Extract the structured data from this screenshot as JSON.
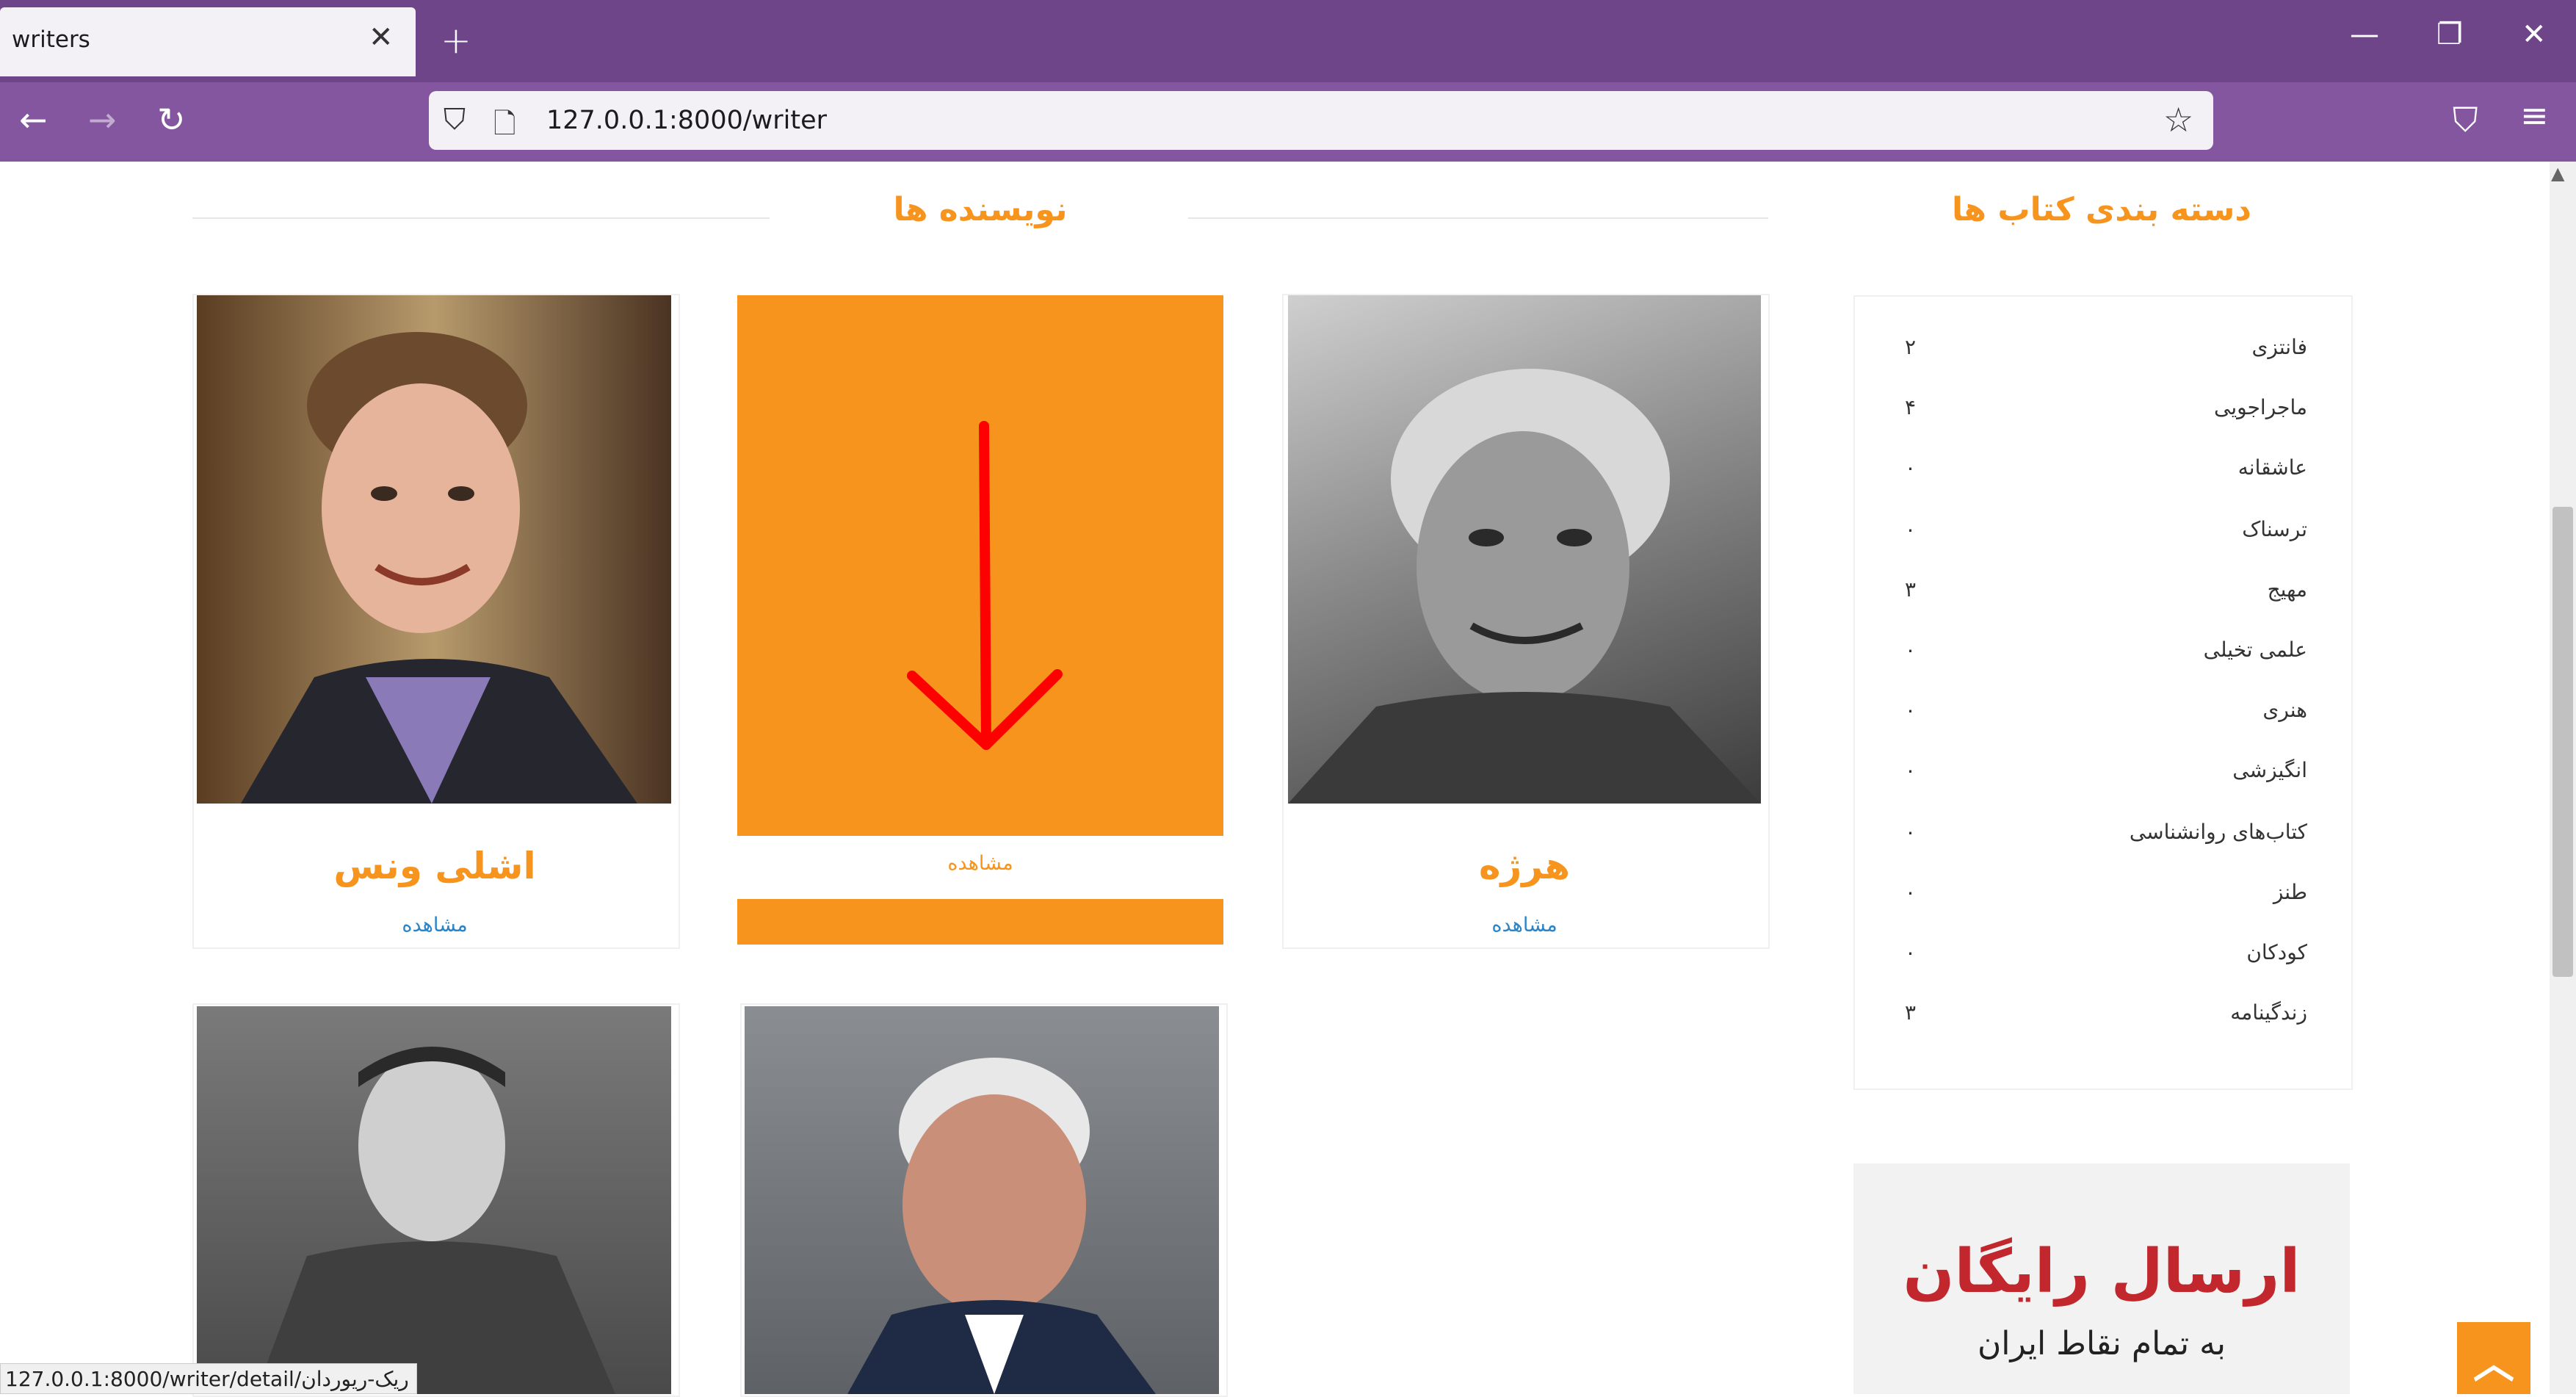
{
  "browser": {
    "tab_title": "writers",
    "tab_close": "✕",
    "new_tab": "+",
    "url": "127.0.0.1:8000/writer",
    "status_url": "127.0.0.1:8000/writer/detail/ریک-ریوردان"
  },
  "window_controls": {
    "minimize": "—",
    "restore": "❐",
    "close": "✕"
  },
  "nav_icons": {
    "back": "←",
    "forward": "→",
    "reload": "↻",
    "shield": "⛉",
    "page": "🗋",
    "star": "☆",
    "pocket": "⛉",
    "menu": "≡"
  },
  "page": {
    "writers_heading": "نویسنده ها",
    "categories_heading": "دسته بندی کتاب ها",
    "cards": [
      {
        "name": "هرژه",
        "view": "مشاهده"
      },
      {
        "name": "",
        "view": "مشاهده"
      },
      {
        "name": "اشلی ونس",
        "view": "مشاهده"
      }
    ],
    "categories": [
      {
        "label": "فانتزی",
        "count": "۲"
      },
      {
        "label": "ماجراجویی",
        "count": "۴"
      },
      {
        "label": "عاشقانه",
        "count": "۰"
      },
      {
        "label": "ترسناک",
        "count": "۰"
      },
      {
        "label": "مهیج",
        "count": "۳"
      },
      {
        "label": "علمی تخیلی",
        "count": "۰"
      },
      {
        "label": "هنری",
        "count": "۰"
      },
      {
        "label": "انگیزشی",
        "count": "۰"
      },
      {
        "label": "کتاب‌های روانشناسی",
        "count": "۰"
      },
      {
        "label": "طنز",
        "count": "۰"
      },
      {
        "label": "کودکان",
        "count": "۰"
      },
      {
        "label": "زندگینامه",
        "count": "۳"
      }
    ],
    "banner": {
      "line1": "ارسال رایگان",
      "line2": "به تمام نقاط ایران"
    },
    "scroll_top": "︿"
  },
  "colors": {
    "accent": "#f7941d",
    "browser_purple": "#8556a0",
    "link": "#2a85c8",
    "arrow": "#ff0000"
  }
}
